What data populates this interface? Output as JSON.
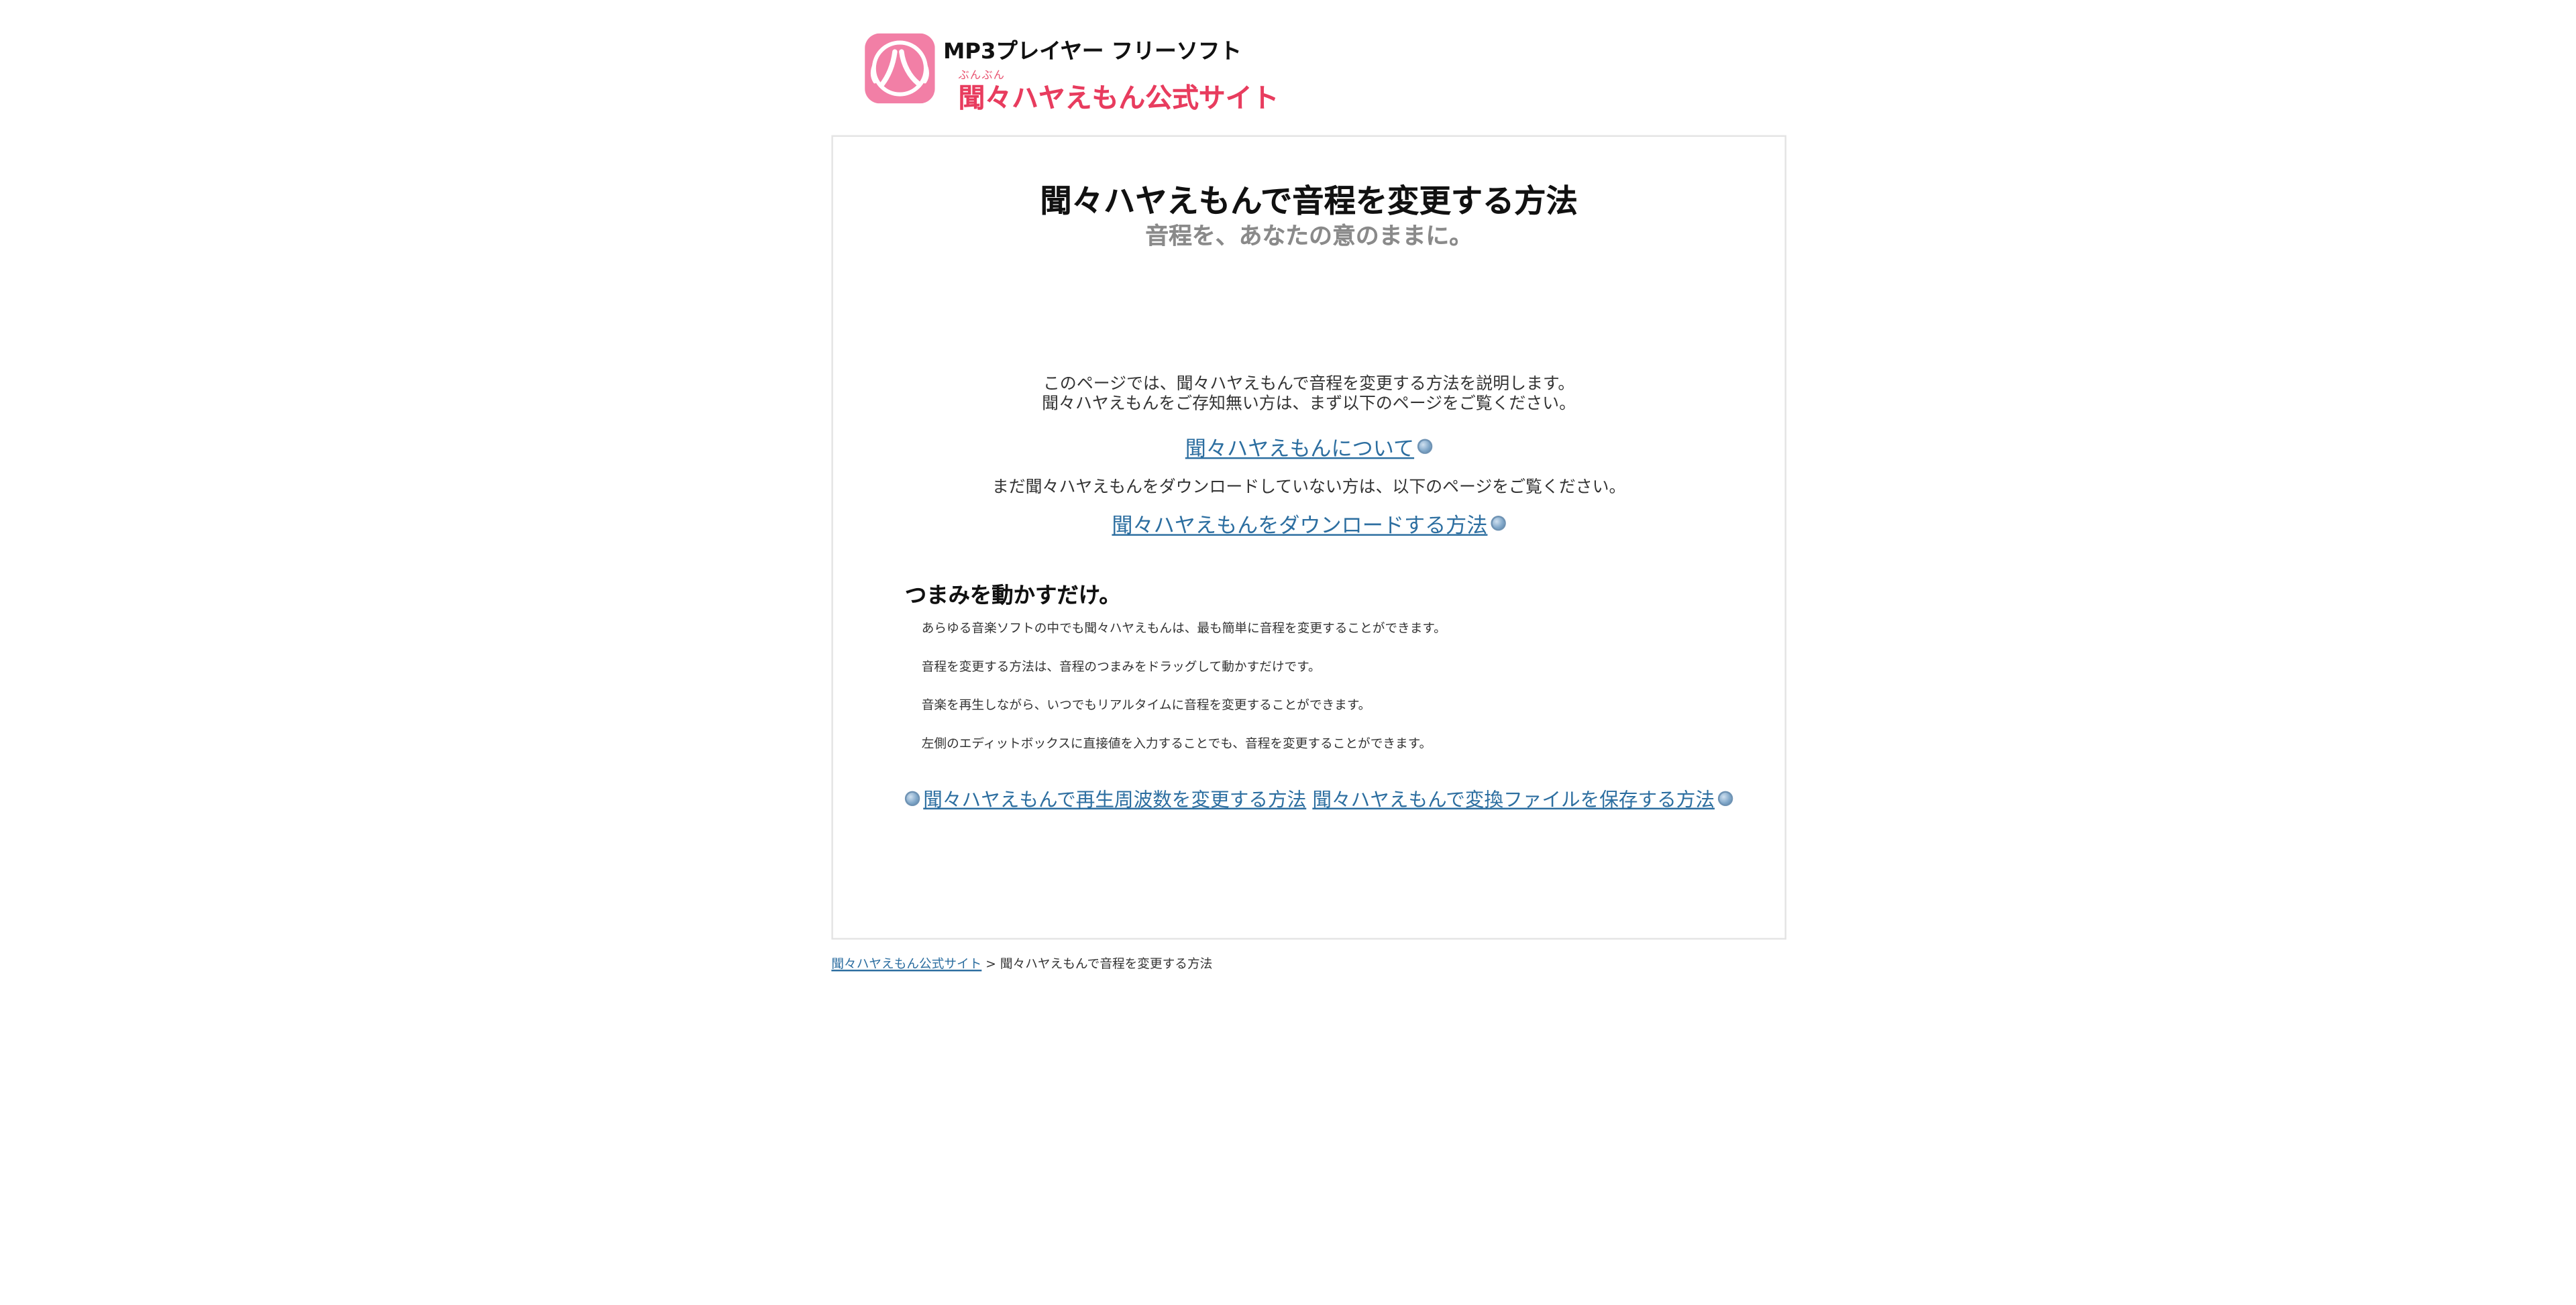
{
  "header": {
    "brand_top": "MP3プレイヤー フリーソフト",
    "brand_ruby": "ぶんぶん",
    "brand_name": "聞々ハヤえもん公式サイト",
    "logo_icon": "hayaemon-logo-icon",
    "logo_color": "#f27fa6"
  },
  "main": {
    "title": "聞々ハヤえもんで音程を変更する方法",
    "subtitle": "音程を、あなたの意のままに。",
    "intro": [
      "このページでは、聞々ハヤえもんで音程を変更する方法を説明します。",
      "聞々ハヤえもんをご存知無い方は、まず以下のページをご覧ください。"
    ],
    "link_about": "聞々ハヤえもんについて",
    "download_note": "まだ聞々ハヤえもんをダウンロードしていない方は、以下のページをご覧ください。",
    "link_download": "聞々ハヤえもんをダウンロードする方法",
    "section_heading": "つまみを動かすだけ。",
    "section_body": [
      "あらゆる音楽ソフトの中でも聞々ハヤえもんは、最も簡単に音程を変更することができます。",
      "音程を変更する方法は、音程のつまみをドラッグして動かすだけです。",
      "音楽を再生しながら、いつでもリアルタイムに音程を変更することができます。",
      "左側のエディットボックスに直接値を入力することでも、音程を変更することができます。"
    ],
    "prev_link": "聞々ハヤえもんで再生周波数を変更する方法",
    "next_link": "聞々ハヤえもんで変換ファイルを保存する方法",
    "link_color": "#2c6ea0"
  },
  "breadcrumb": {
    "home": "聞々ハヤえもん公式サイト",
    "separator": ">",
    "current": "聞々ハヤえもんで音程を変更する方法"
  }
}
